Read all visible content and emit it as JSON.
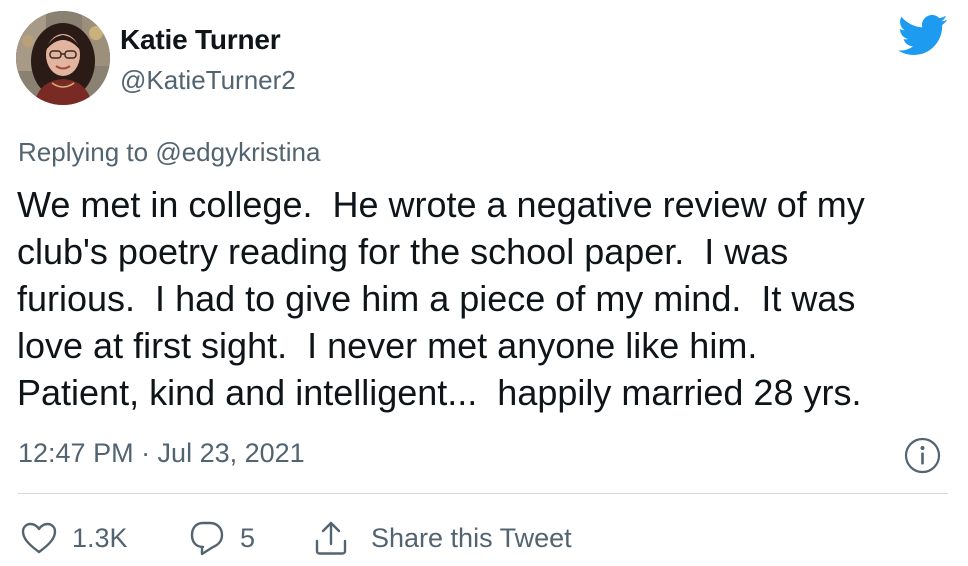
{
  "user": {
    "display_name": "Katie Turner",
    "handle": "@KatieTurner2",
    "avatar_icon": "profile-photo"
  },
  "brand": {
    "icon": "twitter-bird-icon",
    "color": "#1d9bf0"
  },
  "reply_context": {
    "label": "Replying to",
    "handle": "@edgykristina"
  },
  "tweet": {
    "lines": [
      "We met in college.  He wrote a negative review of my",
      "club's poetry reading for the school paper.  I was",
      "furious.  I had to give him a piece of my mind.  It was",
      "love at first sight.  I never met anyone like him.",
      "Patient, kind and intelligent...  happily married 28 yrs."
    ],
    "timestamp": "12:47 PM · Jul 23, 2021"
  },
  "actions": {
    "like_count": "1.3K",
    "reply_count": "5",
    "share_label": "Share this Tweet"
  },
  "colors": {
    "text": "#0f1419",
    "secondary": "#536471",
    "divider": "#cfd9de"
  }
}
